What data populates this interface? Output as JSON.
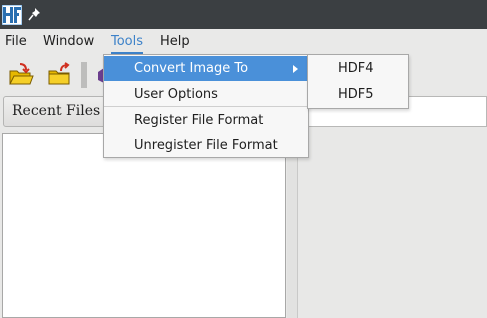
{
  "titlebar": {
    "app_icon": "hdf-logo-icon",
    "pin_icon": "pin-icon"
  },
  "menubar": {
    "items": [
      "File",
      "Window",
      "Tools",
      "Help"
    ],
    "active": "Tools"
  },
  "toolbar": {
    "icons": [
      "open-folder-icon",
      "close-folder-icon"
    ]
  },
  "recent_files": {
    "label": "Recent Files"
  },
  "tools_menu": {
    "items": [
      {
        "label": "Convert Image To",
        "has_submenu": true,
        "highlighted": true
      },
      {
        "label": "User Options",
        "has_submenu": false,
        "highlighted": false
      },
      {
        "label": "Register File Format",
        "has_submenu": false,
        "highlighted": false
      },
      {
        "label": "Unregister File Format",
        "has_submenu": false,
        "highlighted": false
      }
    ]
  },
  "convert_submenu": {
    "items": [
      "HDF4",
      "HDF5"
    ]
  },
  "colors": {
    "titlebar": "#3b3f42",
    "highlight": "#4a90d9",
    "active_menu": "#3d82c9",
    "menu_bg": "#f7f7f7"
  }
}
